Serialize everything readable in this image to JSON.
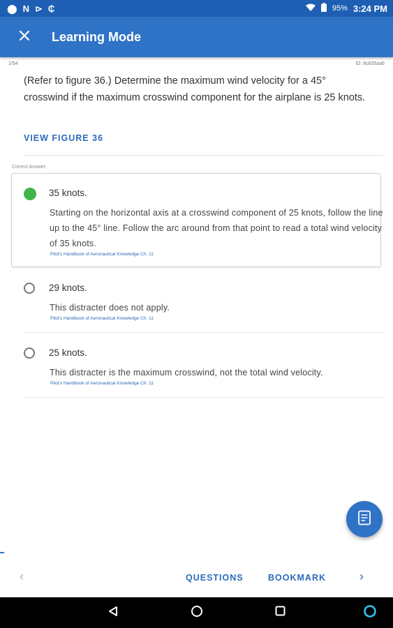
{
  "status_bar": {
    "left_glyphs": [
      "⬤",
      "N",
      "⊳",
      "₵"
    ],
    "battery": "95%",
    "time": "3:24 PM"
  },
  "app_bar": {
    "title": "Learning Mode",
    "close_icon": "close-icon"
  },
  "question": {
    "progress": "1/54",
    "id": "ID: 8c635aa6",
    "text": "(Refer to figure 36.) Determine the maximum wind velocity for a 45° crosswind if the maximum crosswind component for the airplane is 25 knots.",
    "view_figure_label": "VIEW FIGURE 36"
  },
  "correct_answer_label": "Correct Answer",
  "answers": [
    {
      "text": "35 knots.",
      "explanation": "Starting on the horizontal axis at a crosswind component of 25 knots, follow the line up to the 45° line.  Follow the arc around from that point to read a total wind velocity of 35 knots.",
      "reference": "Pilot's Handbook of Aeronautical Knowledge Ch. 11",
      "selected": true
    },
    {
      "text": "29 knots.",
      "explanation": "This distracter does not apply.",
      "reference": "Pilot's Handbook of Aeronautical Knowledge Ch. 11",
      "selected": false
    },
    {
      "text": "25 knots.",
      "explanation": "This distracter is the maximum crosswind, not the total wind velocity.",
      "reference": "Pilot's Handbook of Aeronautical Knowledge Ch. 11",
      "selected": false
    }
  ],
  "bottom_nav": {
    "prev_glyph": "‹",
    "questions_label": "QUESTIONS",
    "bookmark_label": "BOOKMARK",
    "next_glyph": "›"
  },
  "colors": {
    "status_bar": "#1e5fb3",
    "app_bar": "#2f73c6",
    "accent": "#2b6bb8",
    "correct": "#3fb54a"
  }
}
